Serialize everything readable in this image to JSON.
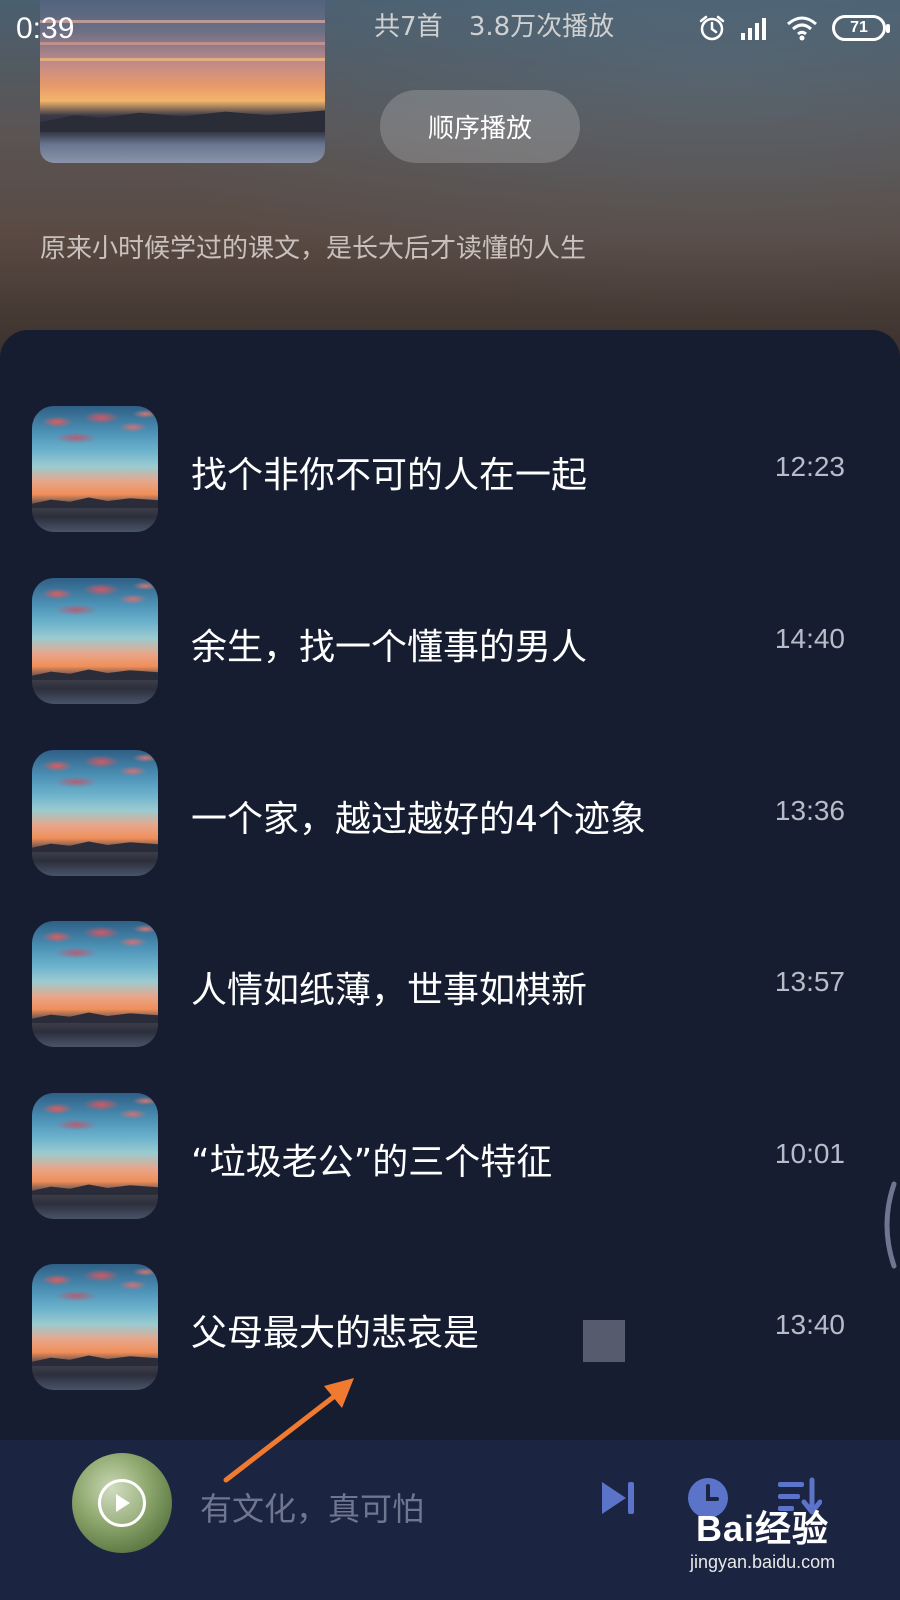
{
  "status_bar": {
    "time": "0:39",
    "battery_level": "71",
    "icons": [
      "alarm-icon",
      "signal-icon",
      "wifi-icon",
      "battery-icon"
    ]
  },
  "playlist": {
    "track_count": "共7首",
    "play_count": "3.8万次播放",
    "sequential_play_label": "顺序播放",
    "description": "原来小时候学过的课文，是长大后才读懂的人生"
  },
  "tracks": [
    {
      "title": "找个非你不可的人在一起",
      "duration": "12:23"
    },
    {
      "title": "余生，找一个懂事的男人",
      "duration": "14:40"
    },
    {
      "title": "一个家，越过越好的4个迹象",
      "duration": "13:36"
    },
    {
      "title": "人情如纸薄，世事如棋新",
      "duration": "13:57"
    },
    {
      "title": "“垃圾老公”的三个特征",
      "duration": "10:01"
    },
    {
      "title": "父母最大的悲哀是",
      "duration": "13:40"
    }
  ],
  "mini_player": {
    "now_playing": "有文化，真可怕",
    "controls": [
      "play-icon",
      "next-track-icon",
      "timer-icon",
      "playlist-icon"
    ]
  },
  "watermark": {
    "brand": "Bai经验",
    "site": "jingyan.baidu.com"
  },
  "colors": {
    "background": "#161d31",
    "mini_player": "#1b2441",
    "accent_icon": "#5b73c9",
    "annotation_arrow": "#f07a30"
  }
}
